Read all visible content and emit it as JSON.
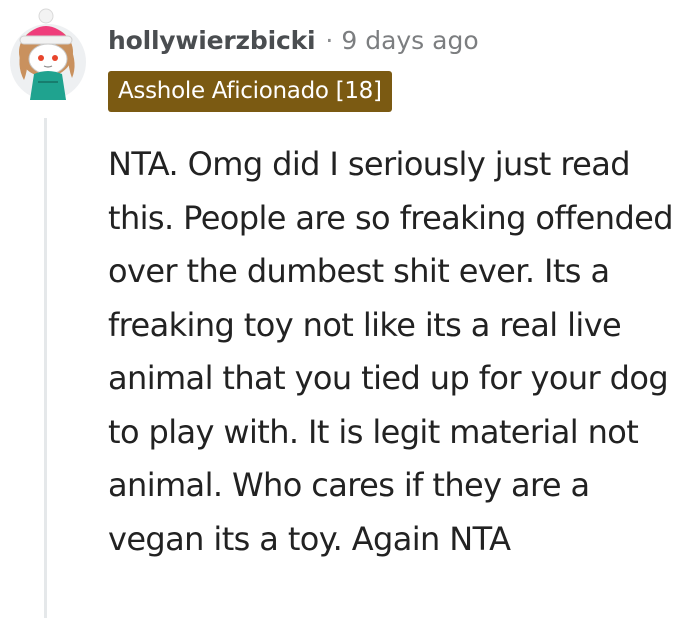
{
  "comment": {
    "username": "hollywierzbicki",
    "separator": "·",
    "timestamp": "9 days ago",
    "flair": "Asshole Aficionado [18]",
    "body": "NTA. Omg did I seriously just read this. People are so freaking offended over the dumbest shit ever. Its a freaking toy not like its a real live animal that you tied up for your dog to play with. It is legit material not animal. Who cares if they are a vegan its a toy. Again NTA",
    "avatar_icon": "snoo-avatar-icon",
    "colors": {
      "flair_background": "#7b5a12",
      "flair_text": "#ffffff",
      "username": "#4a4d50",
      "thread_line": "#e5e8ea"
    }
  }
}
